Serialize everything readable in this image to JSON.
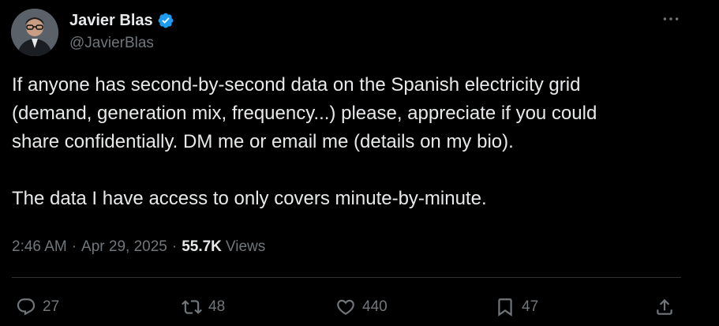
{
  "author": {
    "display_name": "Javier Blas",
    "handle": "@JavierBlas",
    "verified_icon": "verified-badge-icon",
    "avatar": "avatar"
  },
  "more_icon": "more-horizontal-icon",
  "tweet": {
    "lines": [
      "If anyone has second-by-second data on the Spanish electricity grid",
      "(demand, generation mix, frequency...) please, appreciate if you could",
      "share confidentially. DM me or email me (details on my bio).",
      "",
      "The data I have access to only covers minute-by-minute."
    ]
  },
  "meta": {
    "time": "2:46 AM",
    "separator": "·",
    "date": "Apr 29, 2025",
    "views_count": "55.7K",
    "views_label": "Views"
  },
  "actions": {
    "reply": {
      "icon": "reply-icon",
      "count": "27"
    },
    "retweet": {
      "icon": "retweet-icon",
      "count": "48"
    },
    "like": {
      "icon": "heart-icon",
      "count": "440"
    },
    "bookmark": {
      "icon": "bookmark-icon",
      "count": "47"
    },
    "share": {
      "icon": "share-icon"
    }
  },
  "colors": {
    "background": "#000000",
    "text_primary": "#e7e9ea",
    "text_secondary": "#71767b",
    "verified_blue": "#1d9bf0",
    "divider": "#2f3336"
  }
}
